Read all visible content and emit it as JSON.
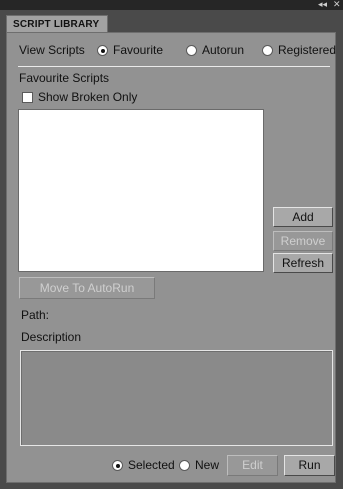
{
  "window": {
    "tab_title": "SCRIPT LIBRARY",
    "controls": {
      "collapse": "◂◂",
      "close": "✕"
    }
  },
  "view_scripts": {
    "label": "View Scripts",
    "options": [
      {
        "label": "Favourite",
        "selected": true
      },
      {
        "label": "Autorun",
        "selected": false
      },
      {
        "label": "Registered",
        "selected": false
      }
    ]
  },
  "favourite_section": {
    "title": "Favourite Scripts",
    "show_broken_only": {
      "label": "Show Broken Only",
      "checked": false
    }
  },
  "buttons": {
    "add": "Add",
    "remove": "Remove",
    "refresh": "Refresh",
    "move_to_autorun": "Move To AutoRun",
    "edit": "Edit",
    "run": "Run"
  },
  "info": {
    "path_label": "Path:",
    "description_label": "Description"
  },
  "bottom": {
    "options": [
      {
        "label": "Selected",
        "selected": true
      },
      {
        "label": "New",
        "selected": false
      }
    ]
  }
}
